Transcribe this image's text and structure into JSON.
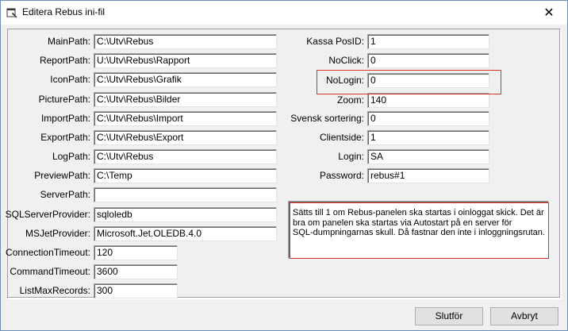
{
  "window": {
    "title": "Editera Rebus ini-fil",
    "close_glyph": "✕"
  },
  "left_fields": [
    {
      "label": "MainPath:",
      "value": "C:\\Utv\\Rebus"
    },
    {
      "label": "ReportPath:",
      "value": "U:\\Utv\\Rebus\\Rapport"
    },
    {
      "label": "IconPath:",
      "value": "C:\\Utv\\Rebus\\Grafik"
    },
    {
      "label": "PicturePath:",
      "value": "C:\\Utv\\Rebus\\Bilder"
    },
    {
      "label": "ImportPath:",
      "value": "C:\\Utv\\Rebus\\Import"
    },
    {
      "label": "ExportPath:",
      "value": "C:\\Utv\\Rebus\\Export"
    },
    {
      "label": "LogPath:",
      "value": "C:\\Utv\\Rebus"
    },
    {
      "label": "PreviewPath:",
      "value": "C:\\Temp"
    },
    {
      "label": "ServerPath:",
      "value": ""
    },
    {
      "label": "SQLServerProvider:",
      "value": "sqloledb"
    },
    {
      "label": "MSJetProvider:",
      "value": "Microsoft.Jet.OLEDB.4.0"
    },
    {
      "label": "ConnectionTimeout:",
      "value": "120"
    },
    {
      "label": "CommandTimeout:",
      "value": "3600"
    },
    {
      "label": "ListMaxRecords:",
      "value": "300"
    }
  ],
  "right_fields": [
    {
      "label": "Kassa PosID:",
      "value": "1"
    },
    {
      "label": "NoClick:",
      "value": "0"
    },
    {
      "label": "NoLogin:",
      "value": "0"
    },
    {
      "label": "Zoom:",
      "value": "140"
    },
    {
      "label": "Svensk sortering:",
      "value": "0"
    },
    {
      "label": "Clientside:",
      "value": "1"
    },
    {
      "label": "Login:",
      "value": "SA"
    },
    {
      "label": "Password:",
      "value": "rebus#1"
    }
  ],
  "info": {
    "lines": [
      "Sätts till 1 om Rebus-panelen ska startas i oinloggat skick. Det är",
      "bra om panelen ska startas via Autostart på en server för",
      "SQL-dumpningarnas skull. Då fastnar den inte i inloggningsrutan."
    ]
  },
  "buttons": {
    "finish": "Slutför",
    "cancel": "Avbryt"
  },
  "highlight_color": "#d9342b"
}
